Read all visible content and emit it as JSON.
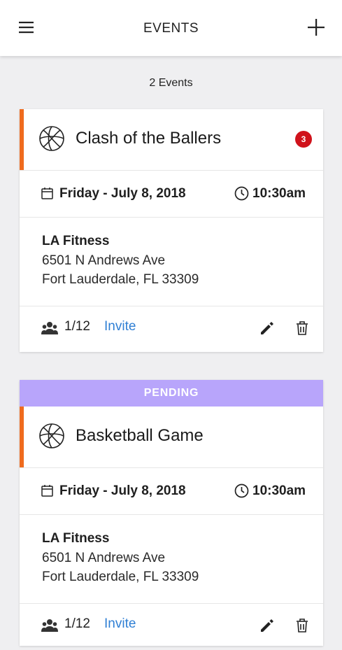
{
  "header": {
    "title": "EVENTS",
    "menu_icon": "hamburger-menu-icon",
    "add_icon": "plus-icon"
  },
  "summary": {
    "count_text": "2 Events"
  },
  "colors": {
    "accent": "#ef6b1e",
    "pending": "#b8a5fb",
    "badge": "#d0121b",
    "link": "#2f7fd4"
  },
  "events": [
    {
      "status": "",
      "name": "Clash of the Ballers",
      "badge": "3",
      "date": "Friday - July 8, 2018",
      "time": "10:30am",
      "venue": "LA Fitness",
      "address_line1": "6501 N Andrews Ave",
      "address_line2": "Fort Lauderdale, FL 33309",
      "players": "1/12",
      "invite_label": "Invite"
    },
    {
      "status": "PENDING",
      "name": "Basketball Game",
      "badge": "",
      "date": "Friday - July 8, 2018",
      "time": "10:30am",
      "venue": "LA Fitness",
      "address_line1": "6501 N Andrews Ave",
      "address_line2": "Fort Lauderdale, FL 33309",
      "players": "1/12",
      "invite_label": "Invite"
    }
  ]
}
